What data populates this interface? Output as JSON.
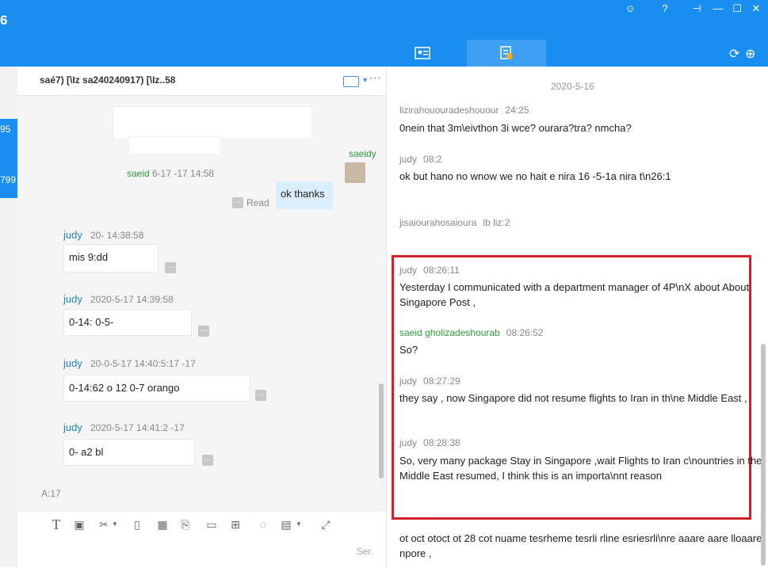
{
  "app": {
    "badge_number": "6"
  },
  "window_controls": [
    "smile-icon",
    "help-icon",
    "pin-icon",
    "minimize-icon",
    "maximize-icon",
    "close-icon"
  ],
  "left_badge": {
    "lines": [
      "95",
      "799"
    ]
  },
  "chat": {
    "header_title": "saé7) [\\Iz sa240240917) [\\Iz..58",
    "messages": [
      {
        "sender": "saeid",
        "time": "6-17     -17 14:58",
        "text": "ok thanks",
        "status": "Read",
        "mine": true,
        "avatar_name": "saeidy"
      },
      {
        "sender": "judy",
        "time": "20-     14:38:58",
        "text": "mis  9:dd"
      },
      {
        "sender": "judy",
        "time": "2020-5-17 14:39:58",
        "text": "0-14:  0-5-"
      },
      {
        "sender": "judy",
        "time": "20-0-5-17 14:40:5:17  -17",
        "text": "0-14:62  o 12    0-7 orango"
      },
      {
        "sender": "judy",
        "time": "2020-5-17 14:41:2  -17",
        "text": "0-  a2   bl"
      }
    ],
    "footer_label": "A:17",
    "send_label": "Ser."
  },
  "right": {
    "date": "2020-5-16",
    "top_messages": [
      {
        "name": "lizirahououradeshouour",
        "time": "24:25",
        "text": "0nein that 3m\\eivthon 3i wce?  ourara?tra?   nmcha?"
      },
      {
        "name": "judy",
        "time": "08:2",
        "text": "  ok   but hano   no wnow we no hait e nira 16  -5-1a   nira t\\n26:1"
      },
      {
        "name": "jisaiourahosaioura",
        "time": "lb liz:2",
        "text": ""
      }
    ],
    "highlight_messages": [
      {
        "name": "judy",
        "time": "08:26:11",
        "green": false,
        "text": "Yesterday I communicated with a department manager of 4P\\nX  about About Singapore Post ,"
      },
      {
        "name": "saeid gholizadeshourab",
        "time": "08:26:52",
        "green": true,
        "text": "So?"
      },
      {
        "name": "judy",
        "time": "08:27:29",
        "green": false,
        "text": "they say , now Singapore did not resume flights to Iran in th\\ne Middle East ,"
      },
      {
        "name": "judy",
        "time": "08:28:38",
        "green": false,
        "text": "So, very many package Stay in Singapore ,wait Flights to Iran c\\nountries in the Middle East resumed, I think this is an importa\\nnt reason"
      }
    ],
    "bottom_text": "ot oct otoct ot 28 cot nuame tesrheme tesrli   rline esriesrli\\nre aaare aare lloaare  npore ,"
  }
}
